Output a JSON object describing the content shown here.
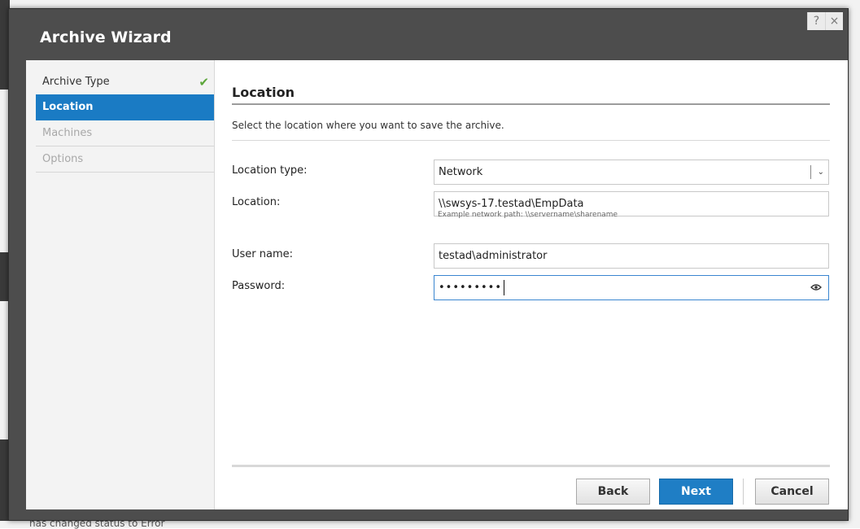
{
  "background": {
    "status_text": "has changed status to Error"
  },
  "dialog": {
    "title": "Archive Wizard",
    "help_glyph": "?",
    "close_glyph": "×"
  },
  "nav": {
    "items": [
      {
        "label": "Archive Type",
        "state": "completed"
      },
      {
        "label": "Location",
        "state": "active"
      },
      {
        "label": "Machines",
        "state": "disabled"
      },
      {
        "label": "Options",
        "state": "disabled"
      }
    ],
    "check_glyph": "✔"
  },
  "pane": {
    "title": "Location",
    "description": "Select the location where you want to save the archive."
  },
  "form": {
    "location_type": {
      "label": "Location type:",
      "value": "Network"
    },
    "location": {
      "label": "Location:",
      "value": "\\\\swsys-17.testad\\EmpData",
      "hint": "Example network path: \\\\servername\\sharename"
    },
    "username": {
      "label": "User name:",
      "value": "testad\\administrator"
    },
    "password": {
      "label": "Password:",
      "masked_value": "•••••••••"
    }
  },
  "buttons": {
    "back": "Back",
    "next": "Next",
    "cancel": "Cancel"
  },
  "colors": {
    "accent": "#1a7bc4",
    "dialog_frame": "#4d4d4d",
    "check": "#5ca63a"
  }
}
